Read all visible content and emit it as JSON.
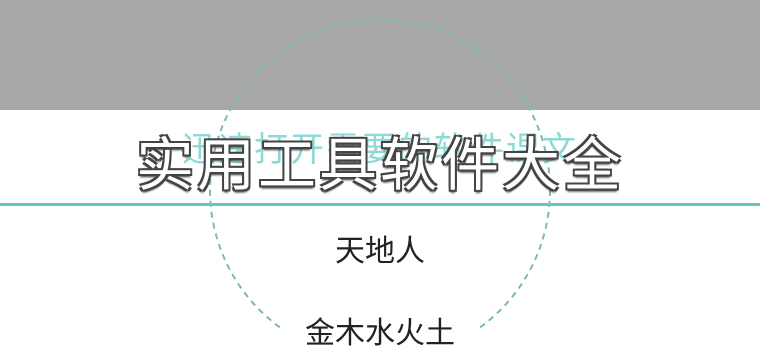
{
  "header": {
    "title": "实用工具软件大全",
    "subtitle": "迅速打开需要的软件课文"
  },
  "menu": {
    "items": [
      {
        "label": "天地人"
      },
      {
        "label": "金木水火土"
      }
    ]
  },
  "colors": {
    "band": "#a8a8a8",
    "accent_teal": "#5ec9c3",
    "subtitle_teal": "#7fd6d2",
    "text": "#222222"
  }
}
